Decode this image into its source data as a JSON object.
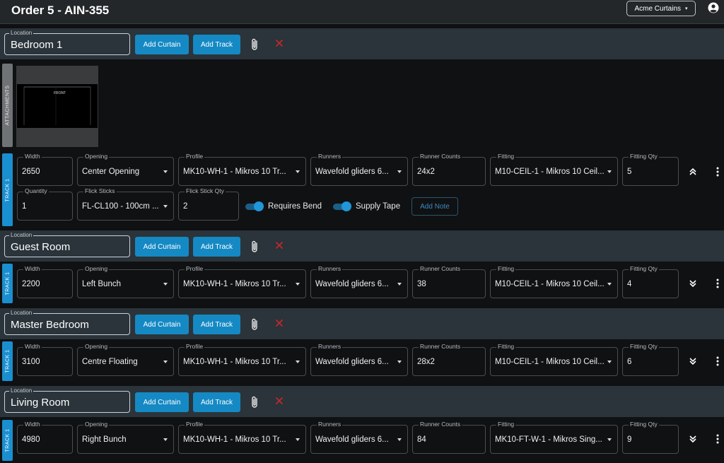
{
  "header": {
    "title": "Order 5 - AIN-355",
    "company": "Acme Curtains"
  },
  "common": {
    "location_label": "Location",
    "add_curtain": "Add Curtain",
    "add_track": "Add Track",
    "attachments_tab": "ATTACHMENTS",
    "track_tab": "TRACK 1",
    "labels": {
      "width": "Width",
      "opening": "Opening",
      "profile": "Profile",
      "runners": "Runners",
      "runner_counts": "Runner Counts",
      "fitting": "Fitting",
      "fitting_qty": "Fitting Qty",
      "quantity": "Quantity",
      "flick_sticks": "Flick Sticks",
      "flick_stick_qty": "Flick Stick Qty"
    }
  },
  "locations": [
    {
      "name": "Bedroom 1",
      "attachment_caption": "FRONT",
      "track": {
        "width": "2650",
        "opening": "Center Opening",
        "profile": "MK10-WH-1 - Mikros 10 Tr...",
        "runners": "Wavefold gliders 6...",
        "runner_counts": "24x2",
        "fitting": "M10-CEIL-1 - Mikros 10 Ceil...",
        "fitting_qty": "5",
        "quantity": "1",
        "flick_sticks": "FL-CL100 - 100cm ...",
        "flick_stick_qty": "2",
        "requires_bend": "Requires Bend",
        "supply_tape": "Supply Tape",
        "add_note": "Add Note"
      }
    },
    {
      "name": "Guest Room",
      "track": {
        "width": "2200",
        "opening": "Left Bunch",
        "profile": "MK10-WH-1 - Mikros 10 Tr...",
        "runners": "Wavefold gliders 6...",
        "runner_counts": "38",
        "fitting": "M10-CEIL-1 - Mikros 10 Ceil...",
        "fitting_qty": "4"
      }
    },
    {
      "name": "Master Bedroom",
      "track": {
        "width": "3100",
        "opening": "Centre Floating",
        "profile": "MK10-WH-1 - Mikros 10 Tr...",
        "runners": "Wavefold gliders 6...",
        "runner_counts": "28x2",
        "fitting": "M10-CEIL-1 - Mikros 10 Ceil...",
        "fitting_qty": "6"
      }
    },
    {
      "name": "Living Room",
      "track": {
        "width": "4980",
        "opening": "Right Bunch",
        "profile": "MK10-WH-1 - Mikros 10 Tr...",
        "runners": "Wavefold gliders 6...",
        "runner_counts": "84",
        "fitting": "MK10-FT-W-1 - Mikros Sing...",
        "fitting_qty": "9"
      }
    }
  ],
  "colors": {
    "accent": "#1589c4",
    "delete": "#c0282d",
    "background": "#0f1012",
    "location_bar": "#2a343a"
  }
}
